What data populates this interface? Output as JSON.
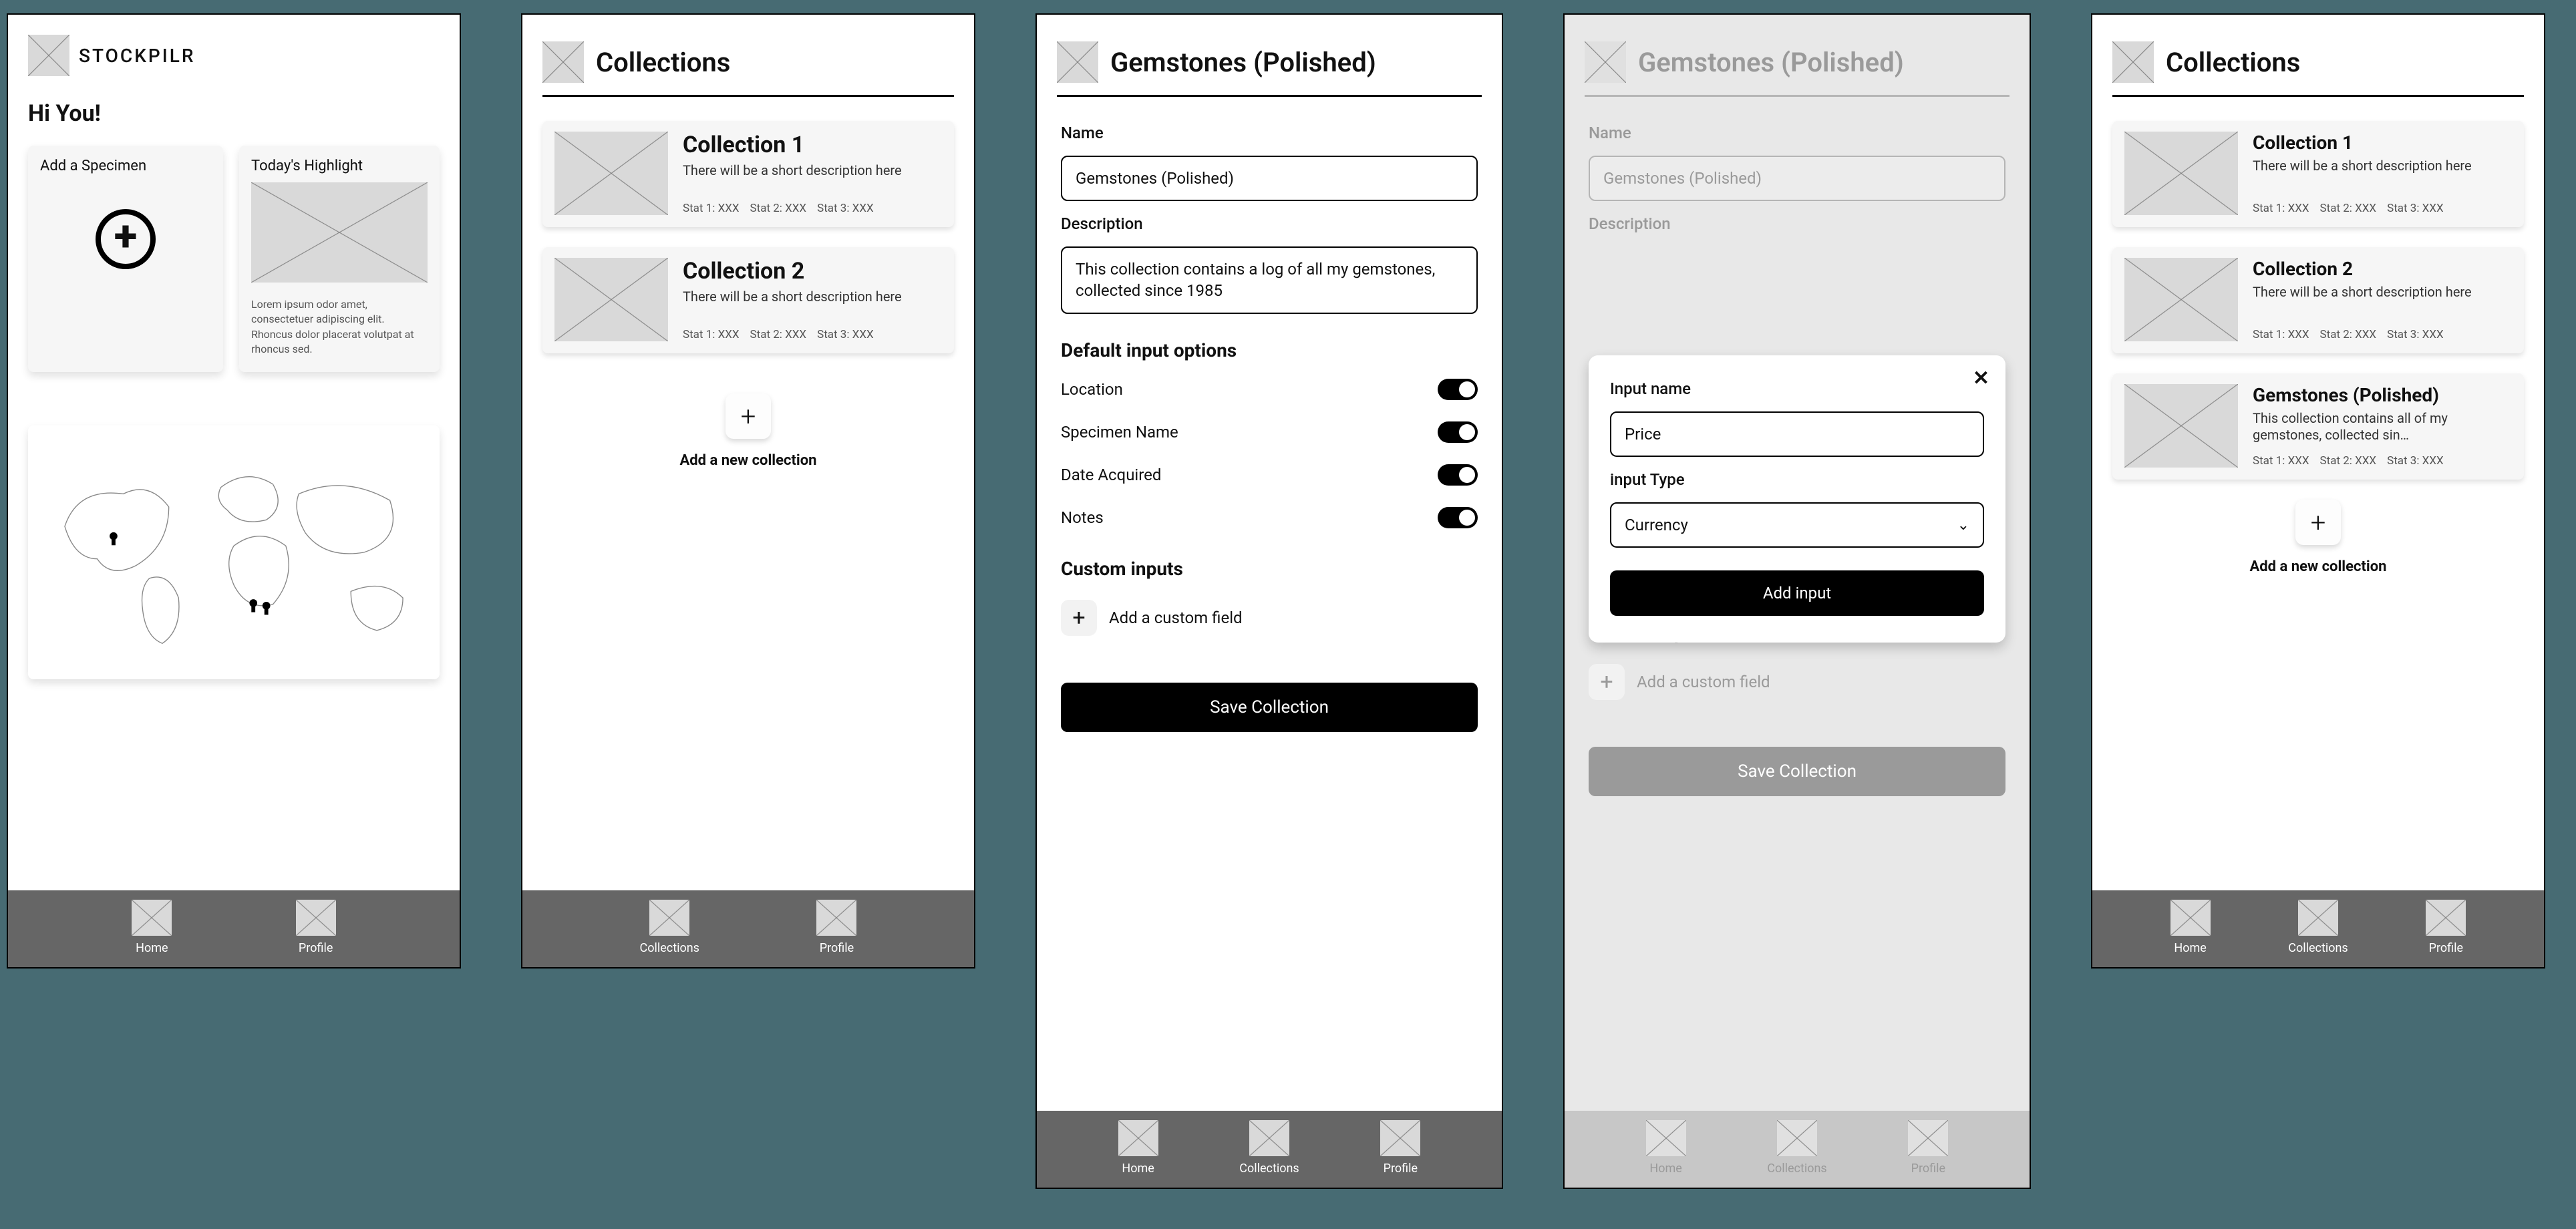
{
  "brand": "STOCKPILR",
  "greeting": "Hi You!",
  "screen1": {
    "addSpecimen": "Add a Specimen",
    "highlightTitle": "Today's Highlight",
    "highlightBlurb": "Lorem ipsum odor amet, consectetuer adipiscing elit. Rhoncus dolor placerat volutpat at rhoncus sed."
  },
  "nav": {
    "home": "Home",
    "collections": "Collections",
    "profile": "Profile"
  },
  "collectionsTitle": "Collections",
  "addCollectionLabel": "Add a new collection",
  "statLabels": {
    "s1": "Stat 1: XXX",
    "s2": "Stat 2: XXX",
    "s3": "Stat 3: XXX"
  },
  "collections2": [
    {
      "title": "Collection 1",
      "desc": "There will be a short description here"
    },
    {
      "title": "Collection 2",
      "desc": "There will be a short description here"
    }
  ],
  "collections5": [
    {
      "title": "Collection 1",
      "desc": "There will be a short description here"
    },
    {
      "title": "Collection 2",
      "desc": "There will be a short description here"
    },
    {
      "title": "Gemstones (Polished)",
      "desc": "This collection contains all of my gemstones, collected sin…"
    }
  ],
  "form": {
    "pageTitle": "Gemstones (Polished)",
    "nameLabel": "Name",
    "nameValue": "Gemstones (Polished)",
    "descLabel": "Description",
    "descValue": "This collection contains a log of all my gemstones, collected since 1985",
    "defaultsTitle": "Default input options",
    "opts": {
      "location": "Location",
      "specimen": "Specimen Name",
      "date": "Date Acquired",
      "notes": "Notes"
    },
    "customTitle": "Custom inputs",
    "addCustom": "Add a custom field",
    "saveBtn": "Save Collection"
  },
  "modal": {
    "nameLabel": "Input name",
    "nameValue": "Price",
    "typeLabel": "input Type",
    "typeValue": "Currency",
    "addBtn": "Add input"
  }
}
